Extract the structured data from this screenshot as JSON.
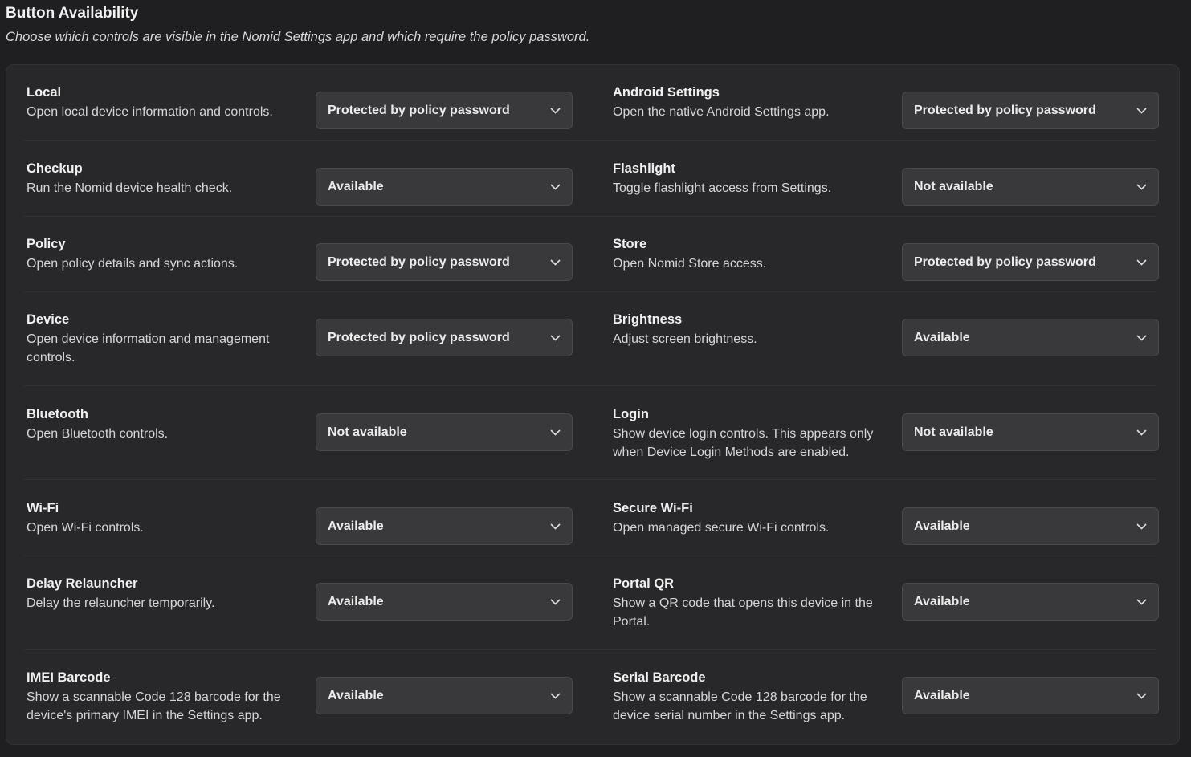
{
  "header": {
    "title": "Button Availability",
    "subtitle": "Choose which controls are visible in the Nomid Settings app and which require the policy password."
  },
  "rows": [
    {
      "left": {
        "label": "Local",
        "desc": "Open local device information and controls.",
        "value": "Protected by policy password"
      },
      "right": {
        "label": "Android Settings",
        "desc": "Open the native Android Settings app.",
        "value": "Protected by policy password"
      }
    },
    {
      "left": {
        "label": "Checkup",
        "desc": "Run the Nomid device health check.",
        "value": "Available"
      },
      "right": {
        "label": "Flashlight",
        "desc": "Toggle flashlight access from Settings.",
        "value": "Not available"
      }
    },
    {
      "left": {
        "label": "Policy",
        "desc": "Open policy details and sync actions.",
        "value": "Protected by policy password"
      },
      "right": {
        "label": "Store",
        "desc": "Open Nomid Store access.",
        "value": "Protected by policy password"
      }
    },
    {
      "left": {
        "label": "Device",
        "desc": "Open device information and management controls.",
        "value": "Protected by policy password"
      },
      "right": {
        "label": "Brightness",
        "desc": "Adjust screen brightness.",
        "value": "Available"
      }
    },
    {
      "left": {
        "label": "Bluetooth",
        "desc": "Open Bluetooth controls.",
        "value": "Not available"
      },
      "right": {
        "label": "Login",
        "desc": "Show device login controls. This appears only when Device Login Methods are enabled.",
        "value": "Not available"
      }
    },
    {
      "left": {
        "label": "Wi-Fi",
        "desc": "Open Wi-Fi controls.",
        "value": "Available"
      },
      "right": {
        "label": "Secure Wi-Fi",
        "desc": "Open managed secure Wi-Fi controls.",
        "value": "Available"
      }
    },
    {
      "left": {
        "label": "Delay Relauncher",
        "desc": "Delay the relauncher temporarily.",
        "value": "Available"
      },
      "right": {
        "label": "Portal QR",
        "desc": "Show a QR code that opens this device in the Portal.",
        "value": "Available"
      }
    },
    {
      "left": {
        "label": "IMEI Barcode",
        "desc": "Show a scannable Code 128 barcode for the device's primary IMEI in the Settings app.",
        "value": "Available"
      },
      "right": {
        "label": "Serial Barcode",
        "desc": "Show a scannable Code 128 barcode for the device serial number in the Settings app.",
        "value": "Available"
      }
    }
  ]
}
